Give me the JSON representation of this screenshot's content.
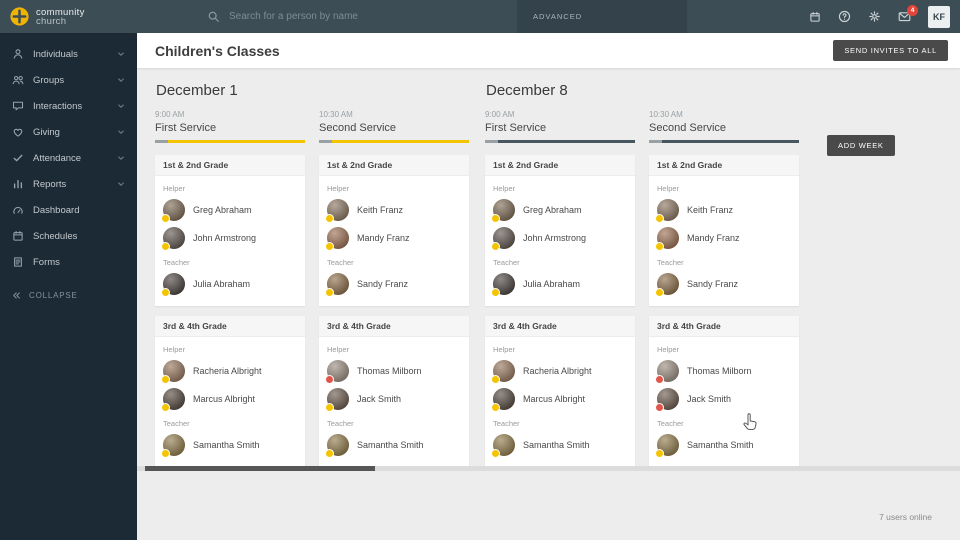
{
  "topbar": {
    "logo_line1": "community",
    "logo_line2": "church",
    "search_placeholder": "Search for a person by name",
    "advanced_label": "ADVANCED",
    "mail_badge": "4",
    "avatar_initials": "KF",
    "icons": [
      {
        "name": "calendar-icon"
      },
      {
        "name": "help-icon"
      },
      {
        "name": "gear-icon"
      },
      {
        "name": "mail-icon"
      }
    ]
  },
  "sidebar": {
    "items": [
      {
        "label": "Individuals",
        "icon": "person-icon",
        "expandable": true
      },
      {
        "label": "Groups",
        "icon": "people-icon",
        "expandable": true
      },
      {
        "label": "Interactions",
        "icon": "chat-icon",
        "expandable": true
      },
      {
        "label": "Giving",
        "icon": "heart-icon",
        "expandable": true
      },
      {
        "label": "Attendance",
        "icon": "check-icon",
        "expandable": true
      },
      {
        "label": "Reports",
        "icon": "chart-icon",
        "expandable": true
      },
      {
        "label": "Dashboard",
        "icon": "gauge-icon",
        "expandable": false
      },
      {
        "label": "Schedules",
        "icon": "calendar-icon",
        "expandable": false
      },
      {
        "label": "Forms",
        "icon": "document-icon",
        "expandable": false
      }
    ],
    "collapse_label": "COLLAPSE"
  },
  "header": {
    "title": "Children's Classes",
    "send_invites_label": "SEND INVITES TO ALL"
  },
  "board": {
    "add_week_label": "ADD WEEK"
  },
  "colors": {
    "accent_yellow": "#f5c400",
    "accent_dark": "#47565f",
    "badge_yellow": "#f5c400",
    "badge_red": "#e25549",
    "topbar_bg": "#3d4d55",
    "sidebar_bg": "#1c2a35",
    "button_dark": "#4a4a4a"
  },
  "weeks": [
    {
      "date": "December 1",
      "services": [
        {
          "time": "9:00 AM",
          "name": "First Service",
          "accent": "yellow",
          "classes": [
            {
              "name": "1st & 2nd Grade",
              "groups": [
                {
                  "role": "Helper",
                  "people": [
                    {
                      "name": "Greg Abraham",
                      "tone": "#7d6a55",
                      "badge": "yellow"
                    },
                    {
                      "name": "John Armstrong",
                      "tone": "#5f554e",
                      "badge": "yellow"
                    }
                  ]
                },
                {
                  "role": "Teacher",
                  "people": [
                    {
                      "name": "Julia Abraham",
                      "tone": "#4a423e",
                      "badge": "yellow"
                    }
                  ]
                }
              ]
            },
            {
              "name": "3rd & 4th Grade",
              "groups": [
                {
                  "role": "Helper",
                  "people": [
                    {
                      "name": "Racheria Albright",
                      "tone": "#96755c",
                      "badge": "yellow"
                    },
                    {
                      "name": "Marcus Albright",
                      "tone": "#55483f",
                      "badge": "yellow"
                    }
                  ]
                },
                {
                  "role": "Teacher",
                  "people": [
                    {
                      "name": "Samantha Smith",
                      "tone": "#8f7a4a",
                      "badge": "yellow"
                    }
                  ]
                }
              ]
            }
          ]
        },
        {
          "time": "10:30 AM",
          "name": "Second Service",
          "accent": "yellow",
          "classes": [
            {
              "name": "1st & 2nd Grade",
              "groups": [
                {
                  "role": "Helper",
                  "people": [
                    {
                      "name": "Keith Franz",
                      "tone": "#8a7560",
                      "badge": "yellow"
                    },
                    {
                      "name": "Mandy Franz",
                      "tone": "#9b6f52",
                      "badge": "yellow"
                    }
                  ]
                },
                {
                  "role": "Teacher",
                  "people": [
                    {
                      "name": "Sandy Franz",
                      "tone": "#8c6e49",
                      "badge": "yellow"
                    }
                  ]
                }
              ]
            },
            {
              "name": "3rd & 4th Grade",
              "groups": [
                {
                  "role": "Helper",
                  "people": [
                    {
                      "name": "Thomas Milborn",
                      "tone": "#9a8d80",
                      "badge": "red"
                    },
                    {
                      "name": "Jack Smith",
                      "tone": "#6b5a4c",
                      "badge": "yellow"
                    }
                  ]
                },
                {
                  "role": "Teacher",
                  "people": [
                    {
                      "name": "Samantha Smith",
                      "tone": "#8f7a4a",
                      "badge": "yellow"
                    }
                  ]
                }
              ]
            }
          ]
        }
      ]
    },
    {
      "date": "December 8",
      "services": [
        {
          "time": "9:00 AM",
          "name": "First Service",
          "accent": "dark",
          "classes": [
            {
              "name": "1st & 2nd Grade",
              "groups": [
                {
                  "role": "Helper",
                  "people": [
                    {
                      "name": "Greg Abraham",
                      "tone": "#7d6a55",
                      "badge": "yellow"
                    },
                    {
                      "name": "John Armstrong",
                      "tone": "#5f554e",
                      "badge": "yellow"
                    }
                  ]
                },
                {
                  "role": "Teacher",
                  "people": [
                    {
                      "name": "Julia Abraham",
                      "tone": "#4a423e",
                      "badge": "yellow"
                    }
                  ]
                }
              ]
            },
            {
              "name": "3rd & 4th Grade",
              "groups": [
                {
                  "role": "Helper",
                  "people": [
                    {
                      "name": "Racheria Albright",
                      "tone": "#96755c",
                      "badge": "yellow"
                    },
                    {
                      "name": "Marcus Albright",
                      "tone": "#55483f",
                      "badge": "yellow"
                    }
                  ]
                },
                {
                  "role": "Teacher",
                  "people": [
                    {
                      "name": "Samantha Smith",
                      "tone": "#8f7a4a",
                      "badge": "yellow"
                    }
                  ]
                }
              ]
            }
          ]
        },
        {
          "time": "10:30 AM",
          "name": "Second Service",
          "accent": "dark",
          "classes": [
            {
              "name": "1st & 2nd Grade",
              "groups": [
                {
                  "role": "Helper",
                  "people": [
                    {
                      "name": "Keith Franz",
                      "tone": "#8a7560",
                      "badge": "yellow"
                    },
                    {
                      "name": "Mandy Franz",
                      "tone": "#9b6f52",
                      "badge": "yellow"
                    }
                  ]
                },
                {
                  "role": "Teacher",
                  "people": [
                    {
                      "name": "Sandy Franz",
                      "tone": "#8c6e49",
                      "badge": "yellow"
                    }
                  ]
                }
              ]
            },
            {
              "name": "3rd & 4th Grade",
              "groups": [
                {
                  "role": "Helper",
                  "people": [
                    {
                      "name": "Thomas Milborn",
                      "tone": "#9a8d80",
                      "badge": "red"
                    },
                    {
                      "name": "Jack Smith",
                      "tone": "#6b5a4c",
                      "badge": "red"
                    }
                  ]
                },
                {
                  "role": "Teacher",
                  "people": [
                    {
                      "name": "Samantha Smith",
                      "tone": "#8f7a4a",
                      "badge": "yellow"
                    }
                  ]
                }
              ]
            }
          ]
        }
      ]
    }
  ],
  "footer": {
    "users_online": "7 users online"
  }
}
